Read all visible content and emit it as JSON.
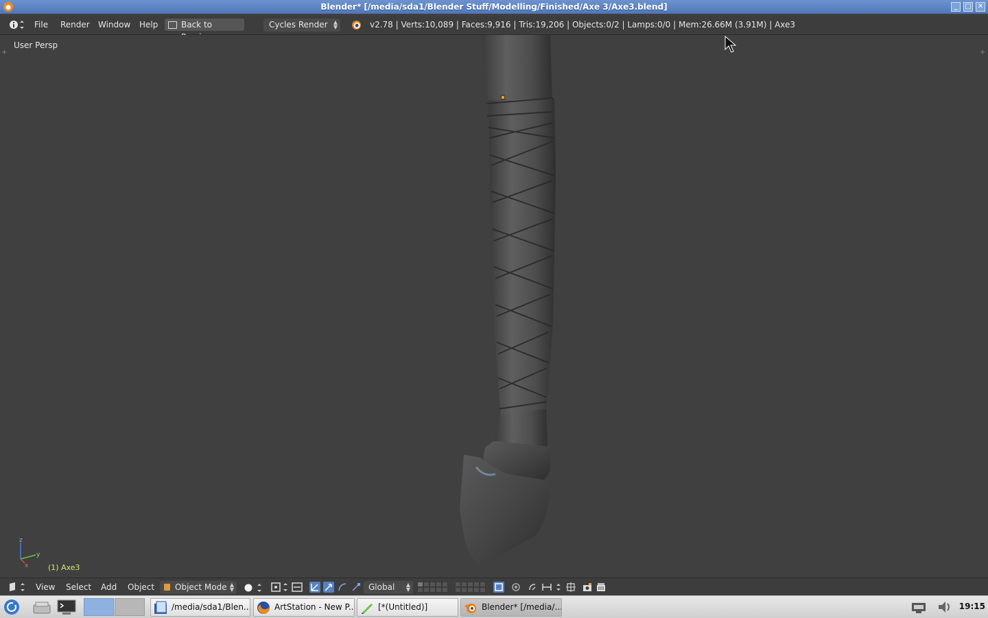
{
  "window": {
    "title": "Blender* [/media/sda1/Blender Stuff/Modelling/Finished/Axe 3/Axe3.blend]",
    "buttons": [
      "minimize",
      "maximize",
      "close"
    ]
  },
  "info_header": {
    "menus": [
      "File",
      "Render",
      "Window",
      "Help"
    ],
    "back_button": "Back to Previous",
    "render_engine": "Cycles Render",
    "stats": "v2.78 | Verts:10,089 | Faces:9,916 | Tris:19,206 | Objects:0/2 | Lamps:0/0 | Mem:26.66M (3.91M) | Axe3"
  },
  "viewport": {
    "view_label": "User Persp",
    "object_label": "(1) Axe3",
    "axis_labels": {
      "x": "x",
      "y": "y",
      "z": "z"
    }
  },
  "view3d_header": {
    "menus": [
      "View",
      "Select",
      "Add",
      "Object"
    ],
    "mode": "Object Mode",
    "orientation": "Global"
  },
  "taskbar": {
    "tasks": [
      {
        "label": "/media/sda1/Blen..."
      },
      {
        "label": "ArtStation - New P..."
      },
      {
        "label": "[*(Untitled)]"
      },
      {
        "label": "Blender* [/media/..."
      }
    ],
    "clock": "19:15"
  },
  "colors": {
    "viewport_bg": "#404040",
    "header_bg": "#3d3d3d",
    "titlebar": "#5c84c4",
    "active_object_label": "#d7e66e"
  }
}
